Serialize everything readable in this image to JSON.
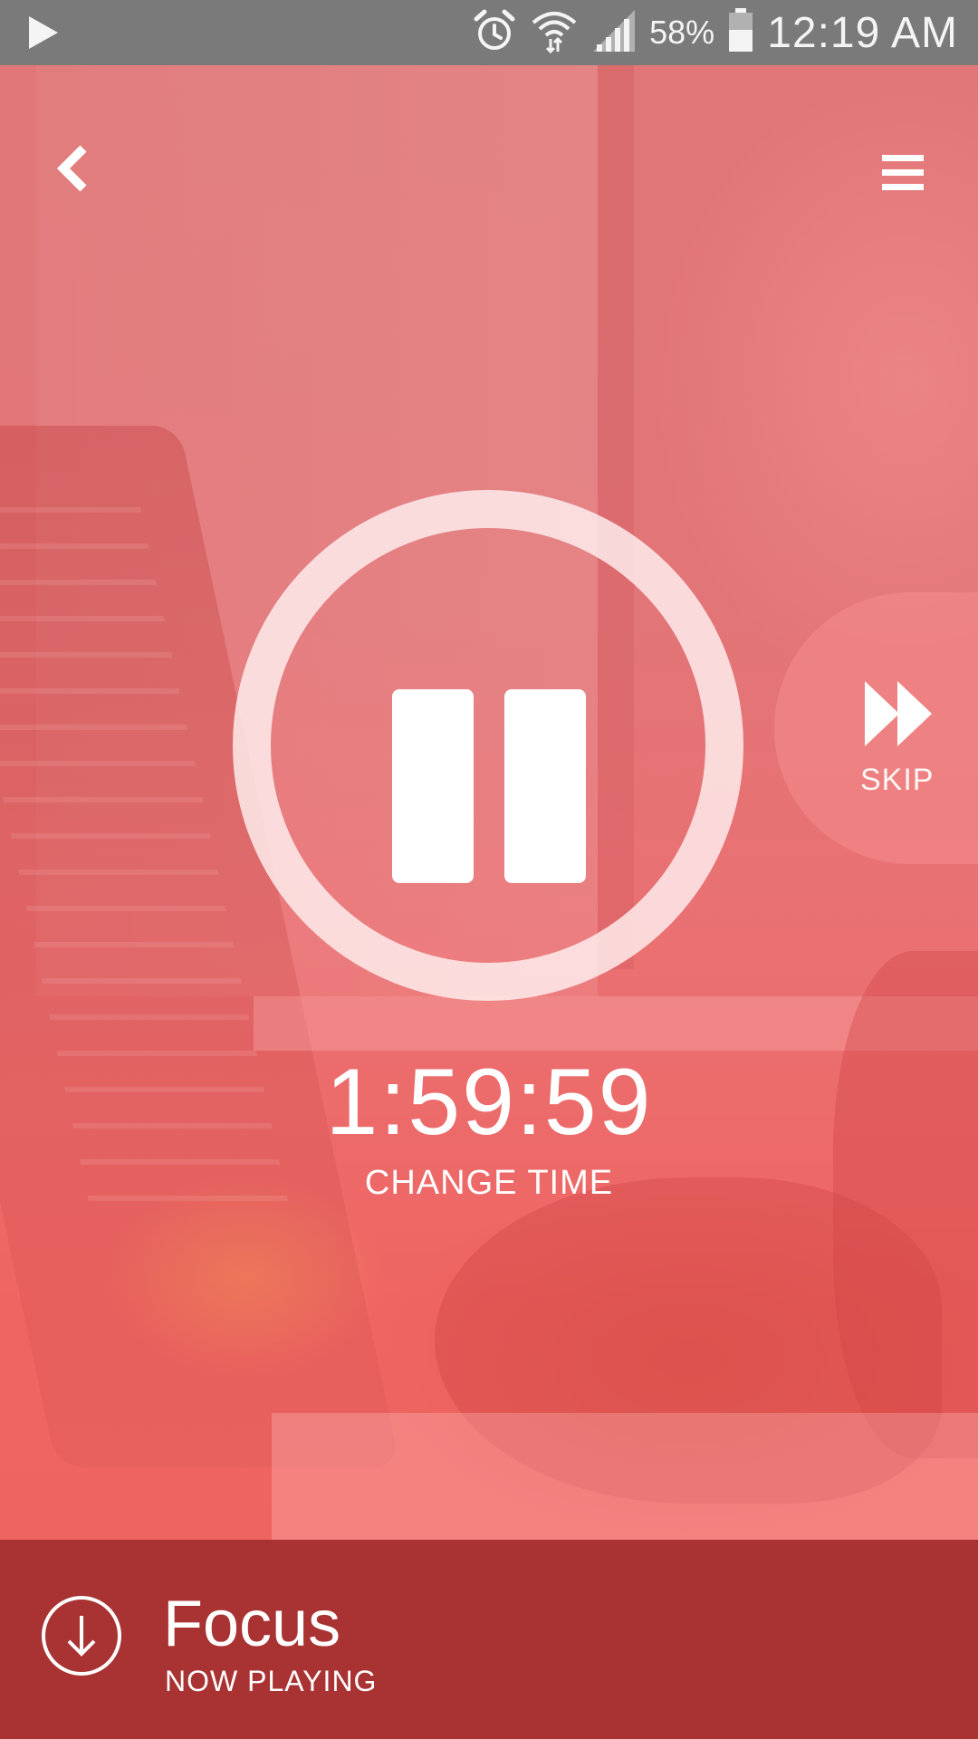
{
  "status_bar": {
    "battery": "58%",
    "time": "12:19 AM",
    "icons": [
      "play-icon",
      "alarm-icon",
      "wifi-icon",
      "signal-icon",
      "battery-icon"
    ]
  },
  "nav": {
    "back_icon": "chevron-left-icon",
    "menu_icon": "hamburger-menu-icon"
  },
  "player": {
    "state_icon": "pause-icon",
    "skip_label": "SKIP",
    "skip_icon": "fast-forward-icon",
    "timer": "1:59:59",
    "change_time_label": "CHANGE TIME"
  },
  "now_playing": {
    "title": "Focus",
    "subtitle": "NOW PLAYING",
    "icon": "download-arrow-icon"
  },
  "colors": {
    "accent": "#e27474",
    "now_playing_bar": "#a23434",
    "status_bar": "#7a7a7a"
  }
}
